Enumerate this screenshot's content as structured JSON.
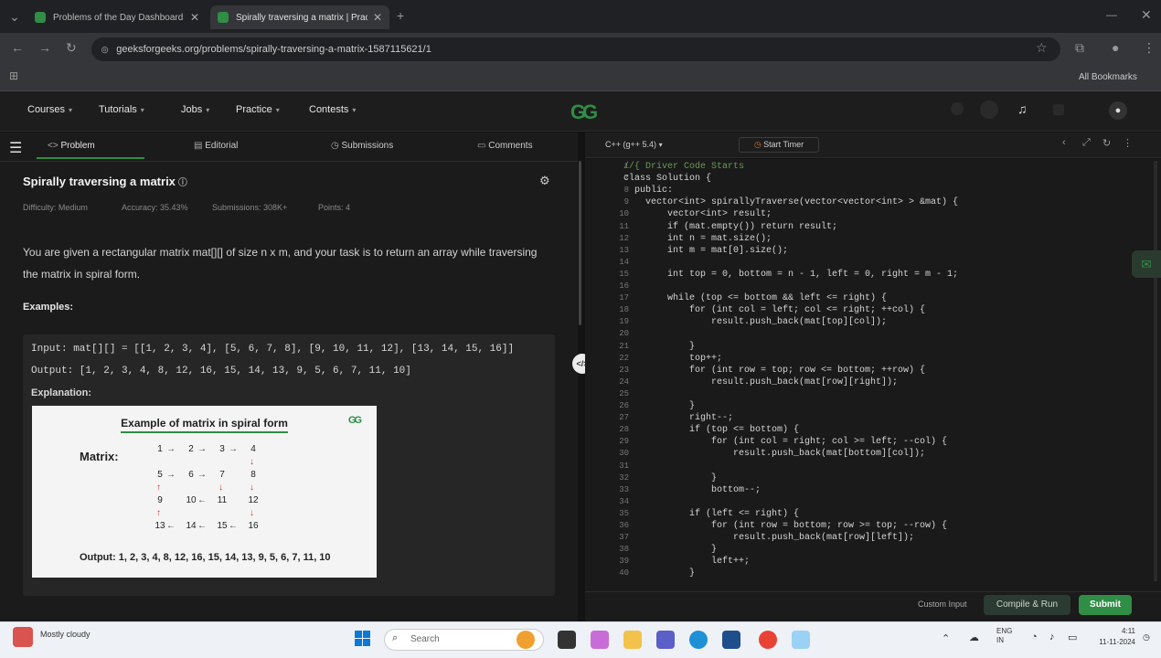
{
  "browser": {
    "tabs": [
      {
        "title": "Problems of the Day Dashboard"
      },
      {
        "title": "Spirally traversing a matrix | Practice"
      }
    ],
    "url": "geeksforgeeks.org/problems/spirally-traversing-a-matrix-1587115621/1",
    "profile_label": "All Bookmarks"
  },
  "site": {
    "menu": [
      "Courses",
      "Tutorials",
      "Jobs",
      "Practice",
      "Contests"
    ],
    "logo": "GG"
  },
  "left": {
    "tabs": [
      "Problem",
      "Editorial",
      "Submissions",
      "Comments"
    ],
    "title": "Spirally traversing a matrix",
    "meta": [
      "Difficulty: Medium",
      "Accuracy: 35.43%",
      "Submissions: 308K+",
      "Points: 4"
    ],
    "description": "You are given a rectangular matrix mat[][] of size n x m, and your task is to return an array while traversing the matrix in spiral form.",
    "examples_heading": "Examples:",
    "input_line": "Input: mat[][] = [[1, 2, 3, 4], [5, 6, 7, 8], [9, 10, 11, 12], [13, 14, 15, 16]]",
    "output_line": "Output: [1, 2, 3, 4, 8, 12, 16, 15, 14, 13, 9, 5, 6, 7, 11, 10]",
    "explanation_label": "Explanation:",
    "figure": {
      "title": "Example of matrix in spiral form",
      "matrix_label": "Matrix:",
      "grid": [
        [
          "1",
          "2",
          "3",
          "4"
        ],
        [
          "5",
          "6",
          "7",
          "8"
        ],
        [
          "9",
          "10",
          "11",
          "12"
        ],
        [
          "13",
          "14",
          "15",
          "16"
        ]
      ],
      "output": "Output: 1, 2, 3, 4, 8, 12, 16, 15, 14, 13, 9, 5, 6, 7, 11, 10"
    }
  },
  "editor": {
    "tabs": [
      "C++ (g++ 5.4)",
      "Start Timer"
    ],
    "lines": [
      {
        "n": "1",
        "t": "//{ Driver Code Starts"
      },
      {
        "n": "7",
        "t": "class Solution {"
      },
      {
        "n": "8",
        "t": "  public:"
      },
      {
        "n": "9",
        "t": "    vector<int> spirallyTraverse(vector<vector<int> > &mat) {"
      },
      {
        "n": "10",
        "t": "        vector<int> result;"
      },
      {
        "n": "11",
        "t": "        if (mat.empty()) return result;"
      },
      {
        "n": "12",
        "t": "        int n = mat.size();"
      },
      {
        "n": "13",
        "t": "        int m = mat[0].size();"
      },
      {
        "n": "14",
        "t": ""
      },
      {
        "n": "15",
        "t": "        int top = 0, bottom = n - 1, left = 0, right = m - 1;"
      },
      {
        "n": "16",
        "t": ""
      },
      {
        "n": "17",
        "t": "        while (top <= bottom && left <= right) {"
      },
      {
        "n": "18",
        "t": "            for (int col = left; col <= right; ++col) {"
      },
      {
        "n": "19",
        "t": "                result.push_back(mat[top][col]);"
      },
      {
        "n": "20",
        "t": ""
      },
      {
        "n": "21",
        "t": "            }"
      },
      {
        "n": "22",
        "t": "            top++;"
      },
      {
        "n": "23",
        "t": "            for (int row = top; row <= bottom; ++row) {"
      },
      {
        "n": "24",
        "t": "                result.push_back(mat[row][right]);"
      },
      {
        "n": "25",
        "t": ""
      },
      {
        "n": "26",
        "t": "            }"
      },
      {
        "n": "27",
        "t": "            right--;"
      },
      {
        "n": "28",
        "t": "            if (top <= bottom) {"
      },
      {
        "n": "29",
        "t": "                for (int col = right; col >= left; --col) {"
      },
      {
        "n": "30",
        "t": "                    result.push_back(mat[bottom][col]);"
      },
      {
        "n": "31",
        "t": ""
      },
      {
        "n": "32",
        "t": "                }"
      },
      {
        "n": "33",
        "t": "                bottom--;"
      },
      {
        "n": "34",
        "t": ""
      },
      {
        "n": "35",
        "t": "            if (left <= right) {"
      },
      {
        "n": "36",
        "t": "                for (int row = bottom; row >= top; --row) {"
      },
      {
        "n": "37",
        "t": "                    result.push_back(mat[row][left]);"
      },
      {
        "n": "38",
        "t": "                }"
      },
      {
        "n": "39",
        "t": "                left++;"
      },
      {
        "n": "40",
        "t": "            }"
      }
    ],
    "custom_input": "Custom Input",
    "compile_run": "Compile & Run",
    "submit": "Submit"
  },
  "taskbar": {
    "weather": "Mostly cloudy",
    "search_placeholder": "Search",
    "lang": "ENG IN",
    "time": "4:11",
    "date": "11-11-2024"
  }
}
